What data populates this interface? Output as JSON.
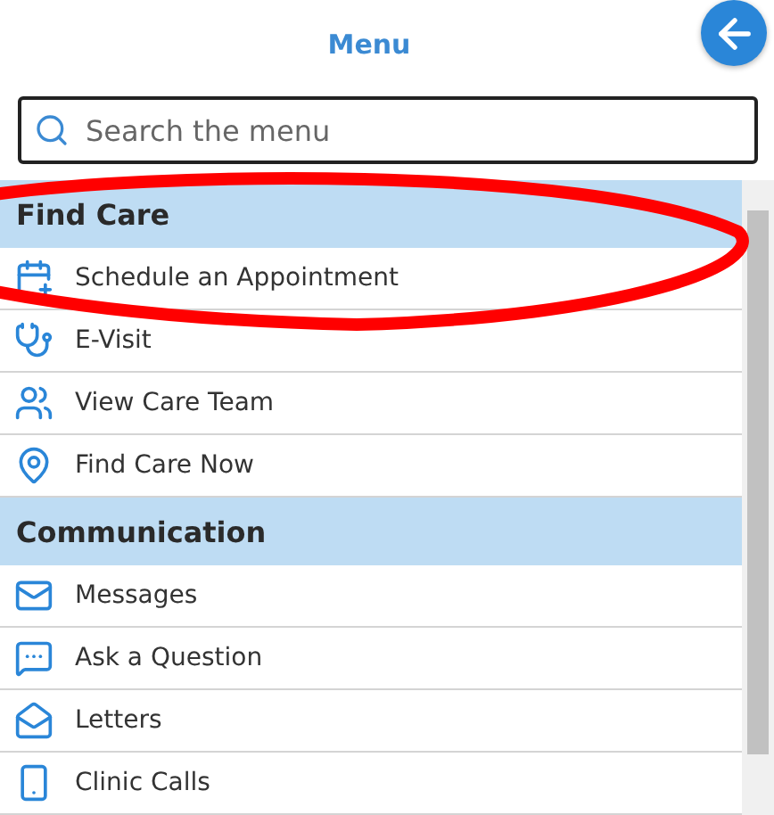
{
  "header": {
    "title": "Menu"
  },
  "search": {
    "placeholder": "Search the menu"
  },
  "sections": [
    {
      "title": "Find Care",
      "items": [
        {
          "label": "Schedule an Appointment"
        },
        {
          "label": "E-Visit"
        },
        {
          "label": "View Care Team"
        },
        {
          "label": "Find Care Now"
        }
      ]
    },
    {
      "title": "Communication",
      "items": [
        {
          "label": "Messages"
        },
        {
          "label": "Ask a Question"
        },
        {
          "label": "Letters"
        },
        {
          "label": "Clinic Calls"
        }
      ]
    }
  ]
}
